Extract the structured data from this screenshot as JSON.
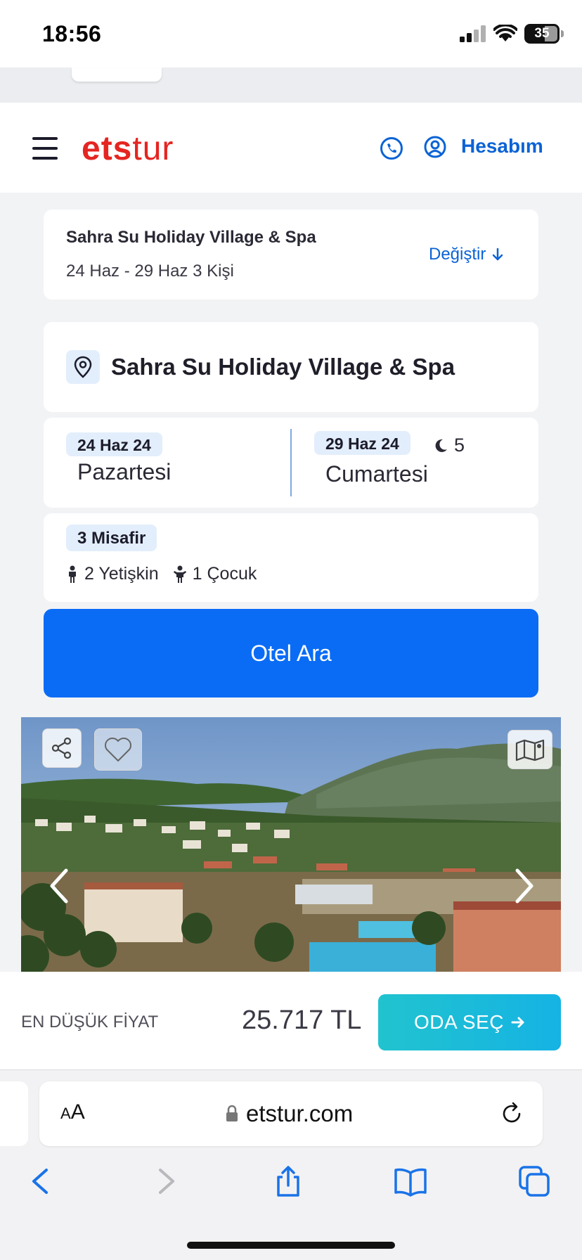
{
  "status_bar": {
    "time": "18:56",
    "battery": "35"
  },
  "header": {
    "logo_bold": "ets",
    "logo_light": "tur",
    "account_label": "Hesabım"
  },
  "summary": {
    "hotel": "Sahra Su Holiday Village & Spa",
    "dates_guests": "24 Haz - 29 Haz 3 Kişi",
    "change_label": "Değiştir"
  },
  "search": {
    "location": "Sahra Su Holiday Village & Spa",
    "checkin_date": "24 Haz 24",
    "checkin_day": "Pazartesi",
    "checkout_date": "29 Haz 24",
    "checkout_day": "Cumartesi",
    "nights": "5",
    "guests_chip": "3 Misafir",
    "adults": "2 Yetişkin",
    "children": "1 Çocuk",
    "button": "Otel Ara"
  },
  "price_bar": {
    "label": "EN DÜŞÜK FİYAT",
    "price": "25.717 TL",
    "button": "ODA SEÇ"
  },
  "browser": {
    "text_size": "AA",
    "url": "etstur.com"
  },
  "colors": {
    "brand_red": "#e52521",
    "link_blue": "#0b63d6",
    "search_blue": "#0a6cf5",
    "cta_teal": "#21c3cf"
  }
}
